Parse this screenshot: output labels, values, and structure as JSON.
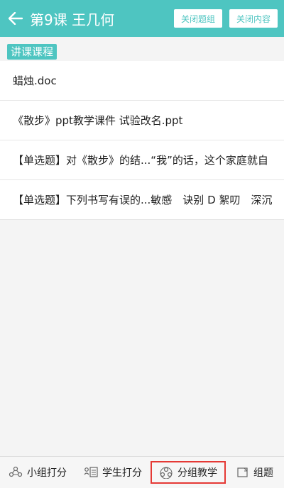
{
  "header": {
    "title": "第9课 王几何",
    "close_group_label": "关闭题组",
    "close_content_label": "关闭内容",
    "bg_color": "#4ec5c1"
  },
  "section": {
    "label": "讲课课程"
  },
  "items": [
    {
      "label": "蜡烛.doc"
    },
    {
      "label": "《散步》ppt教学课件 试验改名.ppt"
    },
    {
      "label": "【单选题】对《散步》的结...“我”的话，这个家庭就自"
    },
    {
      "label": "【单选题】下列书写有误的...敏感　诀别 D 絮叨　深沉"
    }
  ],
  "tabbar": {
    "tabs": [
      {
        "label": "小组打分",
        "icon": "group-score-icon"
      },
      {
        "label": "学生打分",
        "icon": "student-score-icon"
      },
      {
        "label": "分组教学",
        "icon": "group-teaching-icon",
        "active": true
      },
      {
        "label": "组题",
        "icon": "compose-question-icon"
      }
    ],
    "highlight_color": "#e53935"
  }
}
